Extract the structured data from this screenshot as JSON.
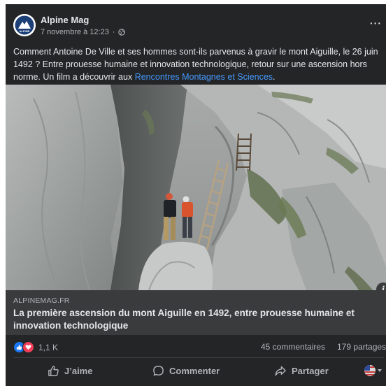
{
  "post": {
    "page_name": "Alpine Mag",
    "timestamp": "7 novembre à 12:23",
    "separator": "·",
    "more_label": "···",
    "caption_text": "Comment Antoine De Ville et ses hommes sont-ils parvenus à gravir le mont Aiguille, le 26 juin 1492 ? Entre prouesse humaine et innovation technologique, retour sur une ascension hors norme. Un film a découvrir aux ",
    "caption_link": "Rencontres Montagnes et Sciences",
    "caption_end": ".",
    "avatar_text": "ALPINE"
  },
  "link_preview": {
    "domain": "ALPINEMAG.FR",
    "title": "La première ascension du mont Aiguille en 1492, entre prouesse humaine et innovation technologique",
    "info_label": "i"
  },
  "stats": {
    "reaction_count": "1,1 K",
    "comments": "45 commentaires",
    "shares": "179 partages"
  },
  "actions": {
    "like": "J’aime",
    "comment": "Commenter",
    "share": "Partager"
  },
  "icons": {
    "avatar": "alpine-mag-logo",
    "privacy": "globe-icon",
    "reaction_like": "like-reaction-icon",
    "reaction_love": "love-reaction-icon",
    "like_button": "thumbs-up-icon",
    "comment_button": "comment-bubble-icon",
    "share_button": "share-arrow-icon",
    "audience": "profile-avatar-selector"
  },
  "colors": {
    "card_background": "#242526",
    "link_box_background": "#3a3b3c",
    "primary_text": "#e4e6eb",
    "secondary_text": "#b0b3b8",
    "link_color": "#4599ff",
    "like_blue": "#1877f2",
    "love_red": "#f33e58"
  }
}
